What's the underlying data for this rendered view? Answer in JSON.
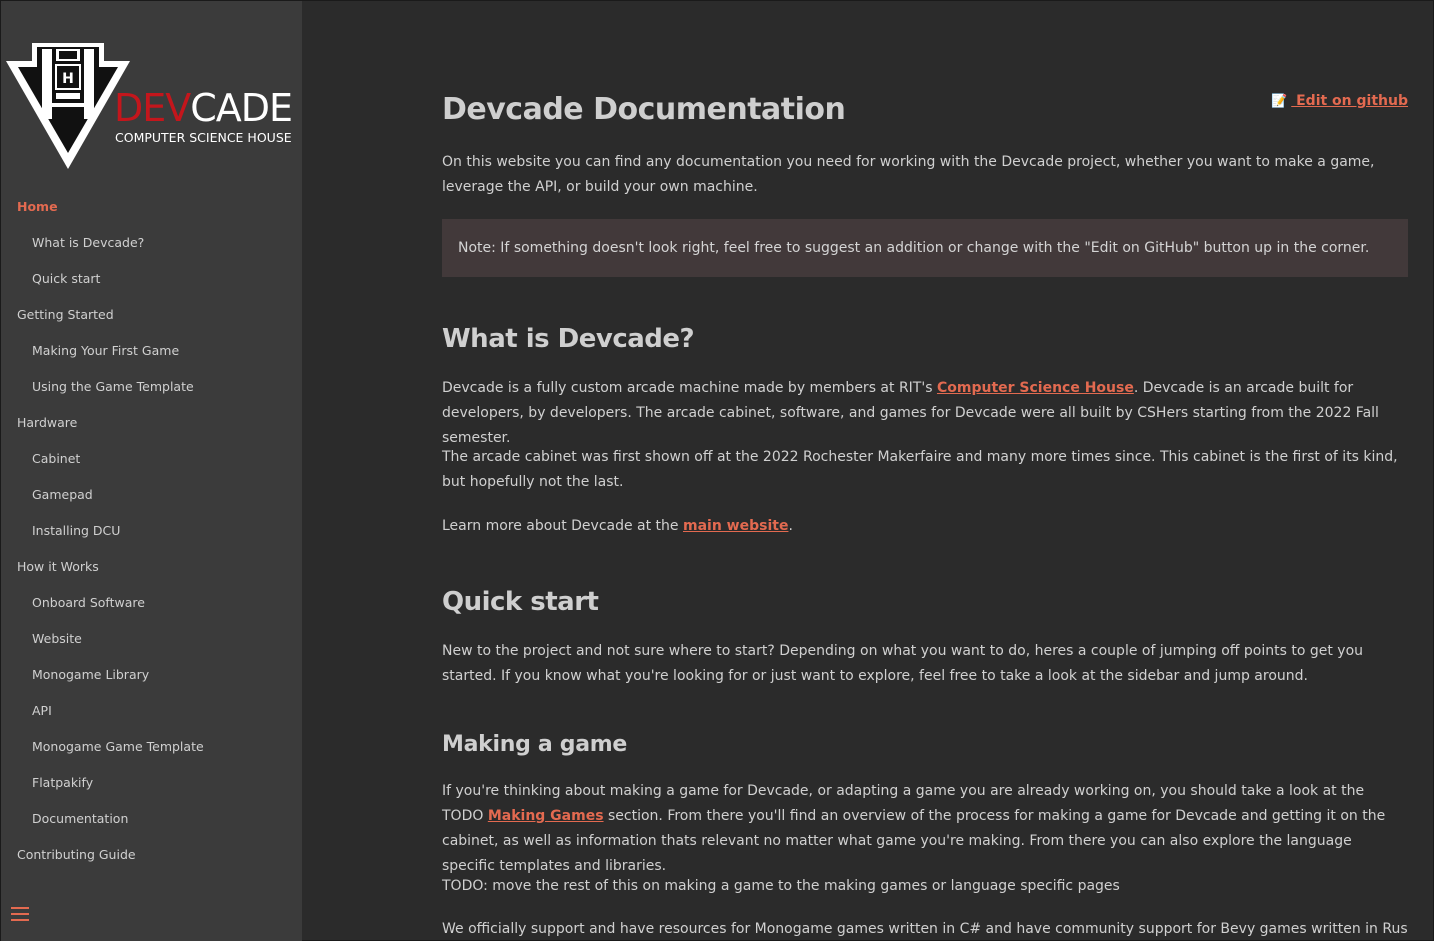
{
  "sidebar": {
    "logo": {
      "title_red": "DEV",
      "title_white": "CADE",
      "subtitle": "COMPUTER SCIENCE HOUSE",
      "emblem_letter": "H"
    },
    "items": [
      {
        "label": "Home",
        "level": 0,
        "active": true
      },
      {
        "label": "What is Devcade?",
        "level": 1,
        "active": false
      },
      {
        "label": "Quick start",
        "level": 1,
        "active": false
      },
      {
        "label": "Getting Started",
        "level": 0,
        "active": false
      },
      {
        "label": "Making Your First Game",
        "level": 1,
        "active": false
      },
      {
        "label": "Using the Game Template",
        "level": 1,
        "active": false
      },
      {
        "label": "Hardware",
        "level": 0,
        "active": false
      },
      {
        "label": "Cabinet",
        "level": 1,
        "active": false
      },
      {
        "label": "Gamepad",
        "level": 1,
        "active": false
      },
      {
        "label": "Installing DCU",
        "level": 1,
        "active": false
      },
      {
        "label": "How it Works",
        "level": 0,
        "active": false
      },
      {
        "label": "Onboard Software",
        "level": 1,
        "active": false
      },
      {
        "label": "Website",
        "level": 1,
        "active": false
      },
      {
        "label": "Monogame Library",
        "level": 1,
        "active": false
      },
      {
        "label": "API",
        "level": 1,
        "active": false
      },
      {
        "label": "Monogame Game Template",
        "level": 1,
        "active": false
      },
      {
        "label": "Flatpakify",
        "level": 1,
        "active": false
      },
      {
        "label": "Documentation",
        "level": 1,
        "active": false
      },
      {
        "label": "Contributing Guide",
        "level": 0,
        "active": false
      }
    ],
    "menu_icon": "hamburger-icon"
  },
  "main": {
    "edit_link": {
      "icon": "pencil-memo-icon",
      "label": " Edit on github"
    },
    "title": "Devcade Documentation",
    "intro": "On this website you can find any documentation you need for working with the Devcade project, whether you want to make a game, leverage the API, or build your own machine.",
    "note": "Note: If something doesn't look right, feel free to suggest an addition or change with the \"Edit on GitHub\" button up in the corner.",
    "what_is": {
      "heading": "What is Devcade?",
      "p1_before": "Devcade is a fully custom arcade machine made by members at RIT's ",
      "p1_link": "Computer Science House",
      "p1_after": ". Devcade is an arcade built for developers, by developers. The arcade cabinet, software, and games for Devcade were all built by CSHers starting from the 2022 Fall semester.",
      "p2": "The arcade cabinet was first shown off at the 2022 Rochester Makerfaire and many more times since. This cabinet is the first of its kind, but hopefully not the last.",
      "p3_before": "Learn more about Devcade at the ",
      "p3_link": "main website",
      "p3_after": "."
    },
    "quick_start": {
      "heading": "Quick start",
      "p1": "New to the project and not sure where to start? Depending on what you want to do, heres a couple of jumping off points to get you started. If you know what you're looking for or just want to explore, feel free to take a look at the sidebar and jump around."
    },
    "making_game": {
      "heading": "Making a game",
      "p1_before": "If you're thinking about making a game for Devcade, or adapting a game you are already working on, you should take a look at the TODO ",
      "p1_link": "Making Games",
      "p1_after": " section. From there you'll find an overview of the process for making a game for Devcade and getting it on the cabinet, as well as information thats relevant no matter what game you're making. From there you can also explore the language specific templates and libraries.",
      "p2": "TODO: move the rest of this on making a game to the making games or language specific pages",
      "p3": "We officially support and have resources for Monogame games written in C# and have community support for Bevy games written in Rust. Many other"
    }
  },
  "colors": {
    "accent": "#e36a50",
    "sidebar_bg": "#3b3b3b",
    "page_bg": "#2b2b2b",
    "note_bg": "#42393a",
    "logo_red": "#c4161c"
  }
}
